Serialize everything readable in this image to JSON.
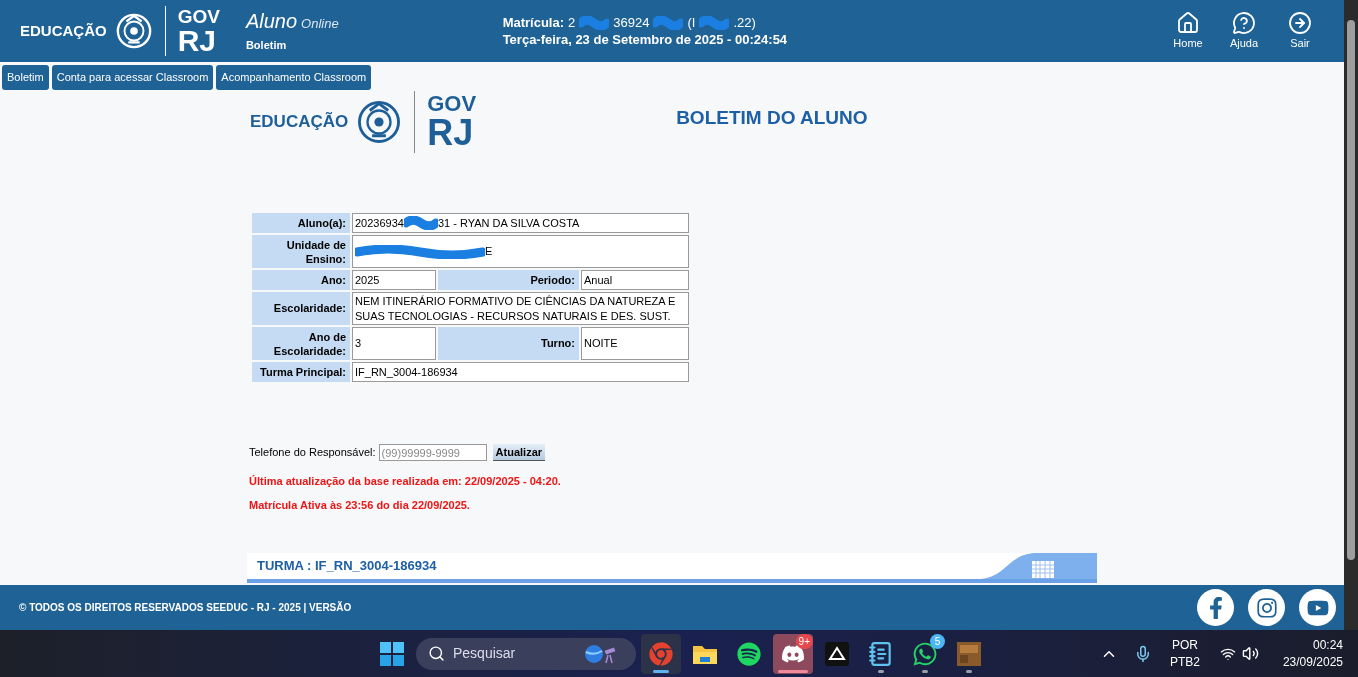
{
  "header": {
    "logo": {
      "left": "EDUCAÇÃO",
      "gov": "GOV",
      "rj": "RJ"
    },
    "app": {
      "name": "Aluno",
      "suffix": "Online",
      "page": "Boletim"
    },
    "matricula": {
      "label": "Matrícula:",
      "fragments": [
        "2",
        "36924",
        "(I",
        ".22)"
      ]
    },
    "datetime": "Terça-feira, 23 de Setembro de 2025 - 00:24:54",
    "nav": [
      {
        "kind": "home",
        "label": "Home"
      },
      {
        "kind": "help",
        "label": "Ajuda"
      },
      {
        "kind": "exit",
        "label": "Sair"
      }
    ]
  },
  "tabs": [
    "Boletim",
    "Conta para acessar Classroom",
    "Acompanhamento Classroom"
  ],
  "page": {
    "logo": {
      "left": "EDUCAÇÃO",
      "gov": "GOV",
      "rj": "RJ"
    },
    "title": "BOLETIM DO ALUNO"
  },
  "student": {
    "aluno": {
      "label": "Aluno(a):",
      "fragments": [
        "20236934",
        "31 - RYAN DA SILVA COSTA"
      ]
    },
    "unidade": {
      "label": "Unidade de Ensino:",
      "fragments": [
        "E"
      ]
    },
    "ano": {
      "label": "Ano:",
      "value": "2025"
    },
    "periodo": {
      "label": "Periodo:",
      "value": "Anual"
    },
    "escolaridade": {
      "label": "Escolaridade:",
      "value": "NEM ITINERÁRIO FORMATIVO DE CIÊNCIAS DA NATUREZA E SUAS TECNOLOGIAS - RECURSOS NATURAIS E DES. SUST."
    },
    "ano_escolaridade": {
      "label": "Ano de Escolaridade:",
      "value": "3"
    },
    "turno": {
      "label": "Turno:",
      "value": "NOITE"
    },
    "turma": {
      "label": "Turma Principal:",
      "value": "IF_RN_3004-186934"
    }
  },
  "phone": {
    "label": "Telefone do Responsável:",
    "placeholder": "(99)99999-9999",
    "button": "Atualizar"
  },
  "notices": [
    "Última atualização da base realizada em: 22/09/2025 - 04:20.",
    "Matrícula Ativa às 23:56 do dia 22/09/2025."
  ],
  "turma_header": "TURMA : IF_RN_3004-186934",
  "footer": {
    "copyright": "© TODOS OS DIREITOS RESERVADOS SEEDUC - RJ - 2025 | VERSÃO",
    "social": [
      {
        "kind": "facebook"
      },
      {
        "kind": "instagram"
      },
      {
        "kind": "youtube"
      }
    ]
  },
  "taskbar": {
    "search_placeholder": "Pesquisar",
    "apps": [
      {
        "kind": "chrome",
        "running": true,
        "selected": true,
        "flashing": false
      },
      {
        "kind": "files",
        "running": false,
        "selected": false,
        "flashing": false
      },
      {
        "kind": "spotify",
        "running": false,
        "selected": false,
        "flashing": false
      },
      {
        "kind": "discord",
        "running": true,
        "selected": false,
        "flashing": true,
        "badge": "9+"
      },
      {
        "kind": "app",
        "running": false,
        "selected": false,
        "flashing": false
      },
      {
        "kind": "notepad",
        "running": true,
        "selected": false,
        "flashing": false
      },
      {
        "kind": "whatsapp",
        "running": true,
        "selected": false,
        "flashing": false,
        "badge": "5"
      },
      {
        "kind": "minecraft",
        "running": true,
        "selected": false,
        "flashing": false
      }
    ],
    "language": "POR",
    "layout": "PTB2",
    "time": "00:24",
    "date": "23/09/2025"
  }
}
